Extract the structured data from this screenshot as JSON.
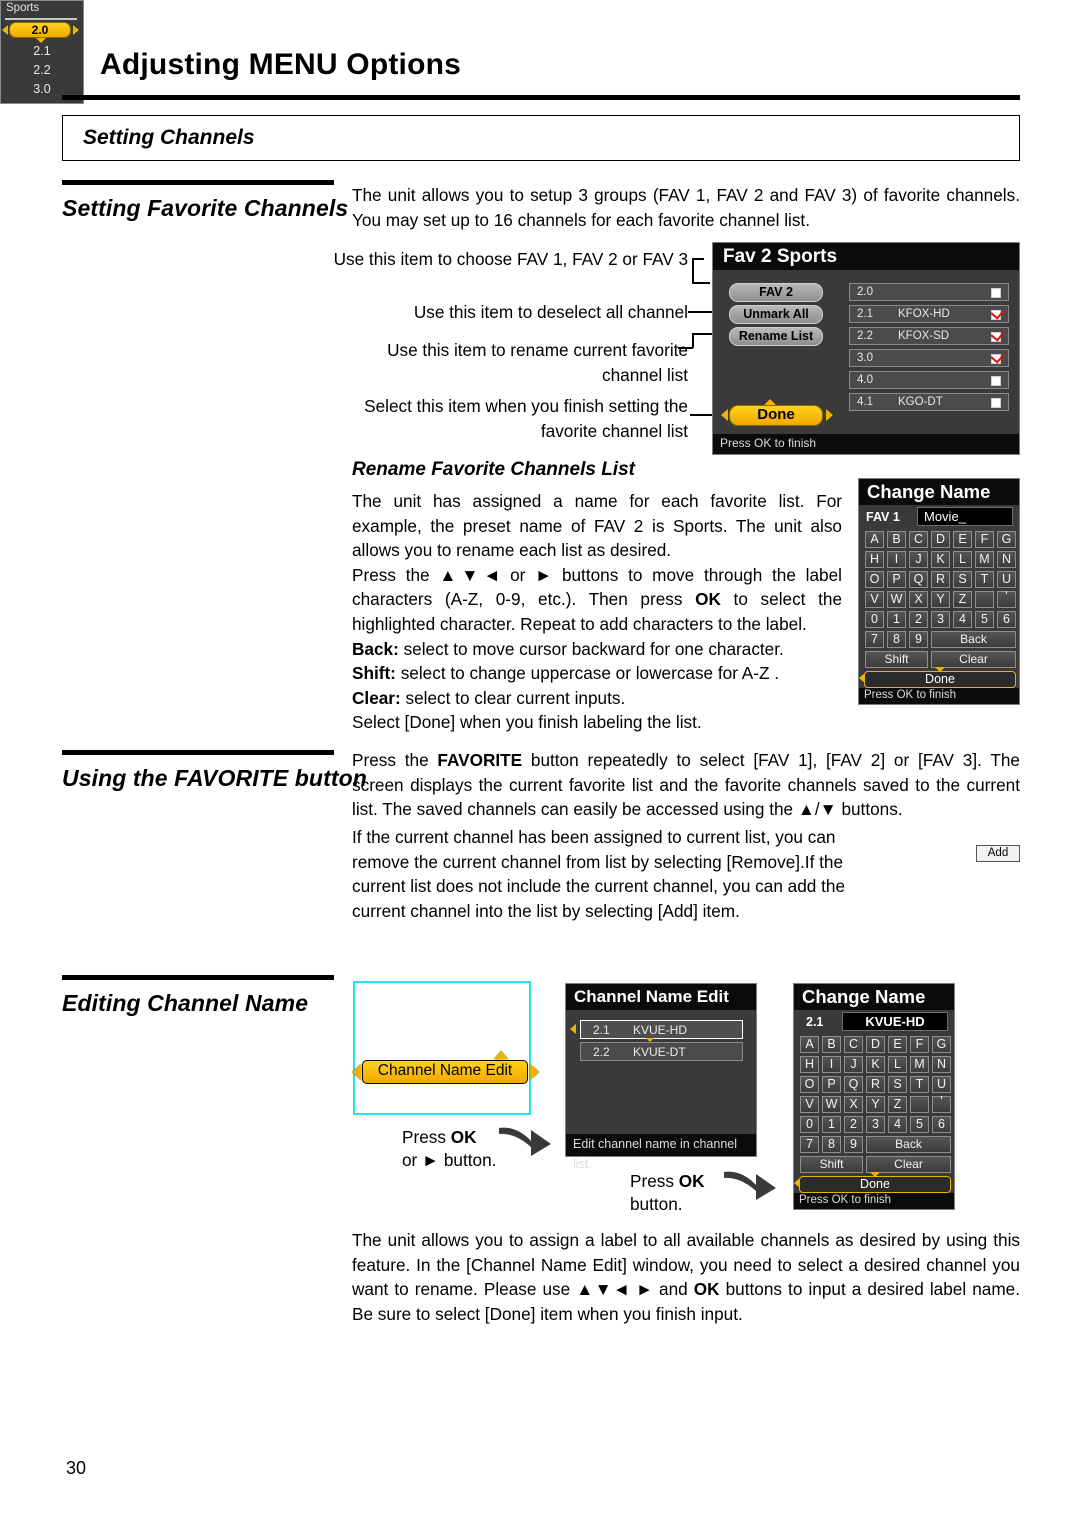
{
  "header": {
    "title": "Adjusting MENU Options",
    "section": "Setting Channels"
  },
  "headings": {
    "favorite": "Setting Favorite Channels",
    "using": "Using the FAVORITE button",
    "editing": "Editing Channel Name"
  },
  "paragraphs": {
    "intro": "The unit allows you to setup 3 groups (FAV 1, FAV 2 and FAV 3) of favorite channels. You may set up to 16 channels for each favorite channel list.",
    "using_1": "Press the FAVORITE button repeatedly to select [FAV 1], [FAV 2] or [FAV 3]. The screen displays the current favorite list and the favorite channels saved to the current list. The saved channels can easily be accessed using the ▲/▼ buttons.",
    "using_2": "If the current channel has been assigned to current list, you can remove the current channel from list by selecting [Remove].If the current list does not include the current channel, you can add the current channel into the list by selecting [Add] item.",
    "bottom": "The unit allows you to assign a label to all available channels as desired by using this feature. In the [Channel Name Edit] window, you need to select a desired channel you want to rename. Please use ▲▼◄ ► and OK buttons to input a desired label name. Be sure to select [Done] item when you finish input."
  },
  "callouts": {
    "choose": "Use this item to choose FAV 1, FAV 2 or FAV 3",
    "deselect": "Use this item to deselect all channel",
    "rename": "Use this item to rename current favorite channel list",
    "finish": "Select this item when you finish setting the favorite channel list"
  },
  "rename_section": {
    "heading": "Rename Favorite Channels List",
    "p1": "The unit has assigned a name for each favorite list. For example, the preset name of FAV 2 is Sports. The unit also allows you to rename each list as desired.",
    "p2": "Press the ▲▼◄ or ► buttons to move through the label characters (A-Z, 0-9, etc.). Then press OK to select the highlighted character. Repeat to add characters to the label.",
    "back_label": "Back:",
    "back_text": " select to move cursor backward for one character.",
    "shift_label": "Shift:",
    "shift_text": " select to change uppercase or lowercase for A-Z .",
    "clear_label": "Clear:",
    "clear_text": " select to clear current inputs.",
    "p3": "Select [Done] when you finish labeling the list."
  },
  "fav2_panel": {
    "title": "Fav 2 Sports",
    "buttons": [
      "FAV 2",
      "Unmark All",
      "Rename List"
    ],
    "channels": [
      {
        "num": "2.0",
        "name": "",
        "checked": false
      },
      {
        "num": "2.1",
        "name": "KFOX-HD",
        "checked": true
      },
      {
        "num": "2.2",
        "name": "KFOX-SD",
        "checked": true
      },
      {
        "num": "3.0",
        "name": "",
        "checked": true
      },
      {
        "num": "4.0",
        "name": "",
        "checked": false
      },
      {
        "num": "4.1",
        "name": "KGO-DT",
        "checked": false
      }
    ],
    "done": "Done",
    "footer": "Press OK to finish"
  },
  "change_name_fav": {
    "title": "Change Name",
    "tag": "FAV 1",
    "value": "Movie_",
    "keys_row1": [
      "A",
      "B",
      "C",
      "D",
      "E",
      "F",
      "G"
    ],
    "keys_row2": [
      "H",
      "I",
      "J",
      "K",
      "L",
      "M",
      "N"
    ],
    "keys_row3": [
      "O",
      "P",
      "Q",
      "R",
      "S",
      "T",
      "U"
    ],
    "keys_row4": [
      "V",
      "W",
      "X",
      "Y",
      "Z",
      "",
      "'"
    ],
    "keys_row5": [
      "0",
      "1",
      "2",
      "3",
      "4",
      "5",
      "6"
    ],
    "keys_row6": [
      "7",
      "8",
      "9"
    ],
    "back": "Back",
    "shift": "Shift",
    "clear": "Clear",
    "done": "Done",
    "footer": "Press OK to finish"
  },
  "change_name_chan": {
    "title": "Change Name",
    "tag": "2.1",
    "value": "KVUE-HD",
    "keys_row1": [
      "A",
      "B",
      "C",
      "D",
      "E",
      "F",
      "G"
    ],
    "keys_row2": [
      "H",
      "I",
      "J",
      "K",
      "L",
      "M",
      "N"
    ],
    "keys_row3": [
      "O",
      "P",
      "Q",
      "R",
      "S",
      "T",
      "U"
    ],
    "keys_row4": [
      "V",
      "W",
      "X",
      "Y",
      "Z",
      "",
      "'"
    ],
    "keys_row5": [
      "0",
      "1",
      "2",
      "3",
      "4",
      "5",
      "6"
    ],
    "keys_row6": [
      "7",
      "8",
      "9"
    ],
    "back": "Back",
    "shift": "Shift",
    "clear": "Clear",
    "done": "Done",
    "footer": "Press OK to finish"
  },
  "sports_widget": {
    "title": "Sports",
    "selected": "2.0",
    "items": [
      "2.1",
      "2.2",
      "3.0"
    ],
    "add_label": "Add"
  },
  "blue_box": {
    "highlight": "Channel Name Edit"
  },
  "press_hints": {
    "hint1_a": "Press ",
    "hint1_b": "OK",
    "hint1_c": "or ► button.",
    "hint2_a": "Press ",
    "hint2_b": "OK",
    "hint2_c": "button."
  },
  "channel_name_edit": {
    "title": "Channel Name Edit",
    "rows": [
      {
        "num": "2.1",
        "name": "KVUE-HD",
        "selected": true
      },
      {
        "num": "2.2",
        "name": "KVUE-DT",
        "selected": false
      }
    ],
    "footer": "Edit channel name in channel list."
  },
  "page_number": "30",
  "colors": {
    "accent_yellow": "#f0b400",
    "cyan_border": "#22e3f0",
    "check_red": "#d81414"
  }
}
